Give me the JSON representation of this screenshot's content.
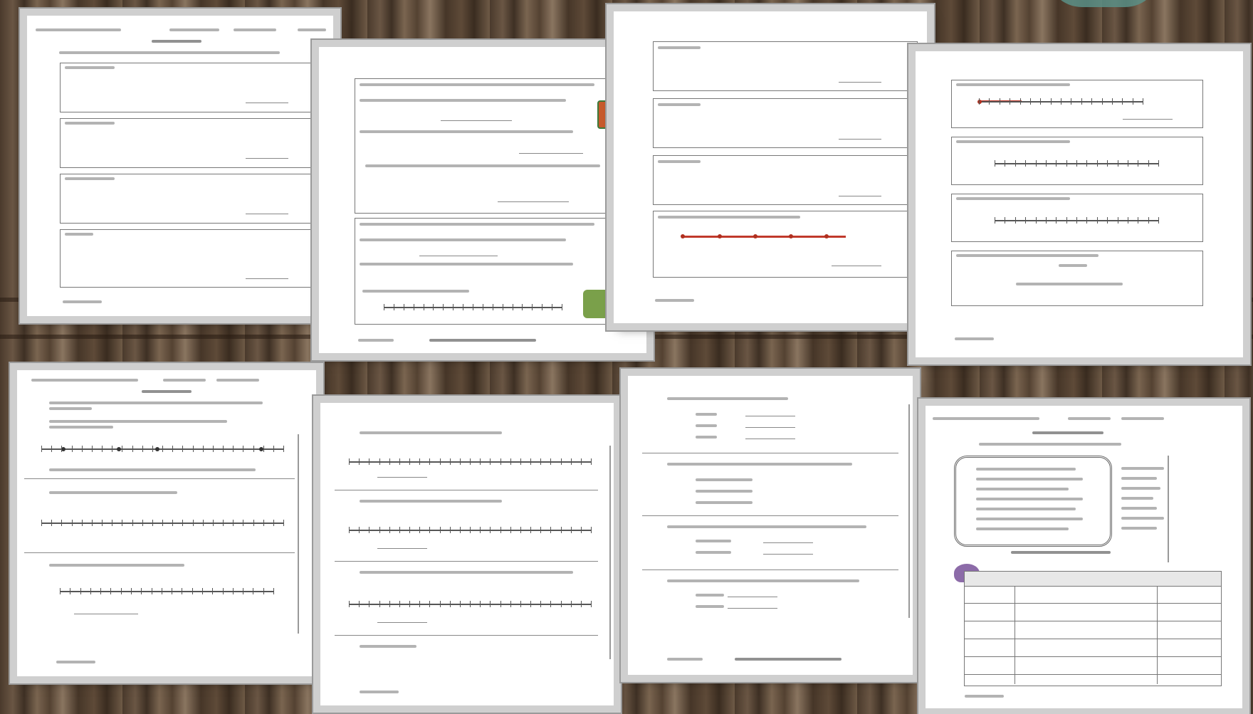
{
  "scene": {
    "background": "dark wood planks",
    "accent_colors": {
      "wood_dark": "#3e3024",
      "wood_light": "#8a7560",
      "paper": "#ffffff",
      "number_line_red": "#c0392b",
      "badge_teal": "#5b8f86"
    },
    "worksheet_count": 8
  },
  "sheets": [
    {
      "id": "sheet-1",
      "kind": "quiz page with four answer boxes"
    },
    {
      "id": "sheet-2",
      "kind": "word problem page with illustrations"
    },
    {
      "id": "sheet-3",
      "kind": "equation boxes and red number line"
    },
    {
      "id": "sheet-4",
      "kind": "number line graphing page"
    },
    {
      "id": "sheet-5",
      "kind": "number line plotting page"
    },
    {
      "id": "sheet-6",
      "kind": "number line practice page"
    },
    {
      "id": "sheet-7",
      "kind": "opposites and absolute value page"
    },
    {
      "id": "sheet-8",
      "kind": "vocabulary quiz with table"
    }
  ]
}
